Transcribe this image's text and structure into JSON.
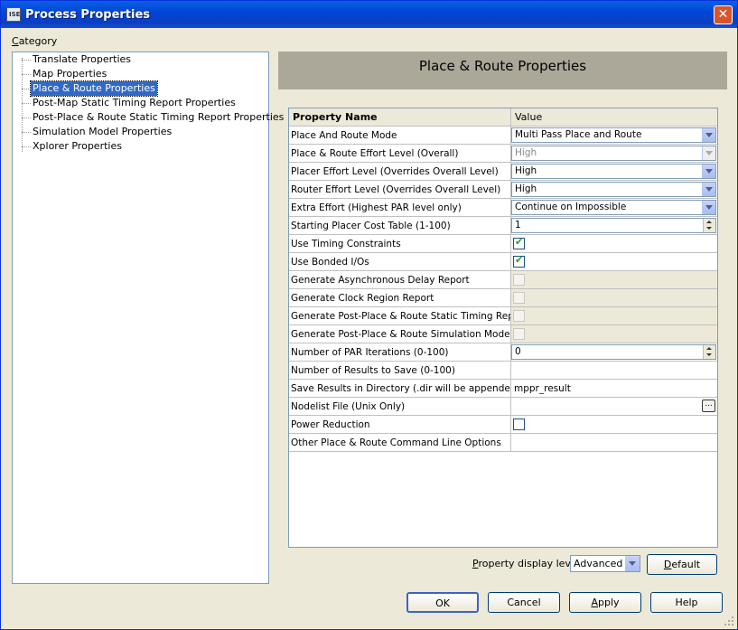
{
  "window": {
    "title": "Process Properties",
    "close": "✕",
    "icon_text": "ISE"
  },
  "category": {
    "label_prefix": "C",
    "label_rest": "ategory",
    "items": [
      {
        "label": "Translate Properties"
      },
      {
        "label": "Map Properties"
      },
      {
        "label": "Place & Route Properties"
      },
      {
        "label": "Post-Map Static Timing Report Properties"
      },
      {
        "label": "Post-Place & Route Static Timing Report Properties"
      },
      {
        "label": "Simulation Model Properties"
      },
      {
        "label": "Xplorer Properties"
      }
    ],
    "selected_index": 2
  },
  "panel": {
    "title": "Place & Route Properties"
  },
  "grid": {
    "headers": {
      "name": "Property Name",
      "value": "Value"
    },
    "rows": [
      {
        "name": "Place And Route Mode",
        "type": "combo",
        "value": "Multi Pass Place and Route"
      },
      {
        "name": "Place & Route Effort Level (Overall)",
        "type": "combo-disabled",
        "value": "High"
      },
      {
        "name": "Placer Effort Level (Overrides Overall Level)",
        "type": "combo",
        "value": "High"
      },
      {
        "name": "Router Effort Level (Overrides Overall Level)",
        "type": "combo",
        "value": "High"
      },
      {
        "name": "Extra Effort (Highest PAR level only)",
        "type": "combo",
        "value": "Continue on Impossible"
      },
      {
        "name": "Starting Placer Cost Table (1-100)",
        "type": "spin",
        "value": "1"
      },
      {
        "name": "Use Timing Constraints",
        "type": "check",
        "checked": true
      },
      {
        "name": "Use Bonded I/Os",
        "type": "check",
        "checked": true
      },
      {
        "name": "Generate Asynchronous Delay Report",
        "type": "check-disabled",
        "checked": false
      },
      {
        "name": "Generate Clock Region Report",
        "type": "check-disabled",
        "checked": false
      },
      {
        "name": "Generate Post-Place & Route Static Timing Report",
        "type": "check-disabled",
        "checked": false
      },
      {
        "name": "Generate Post-Place & Route Simulation Model",
        "type": "check-disabled",
        "checked": false
      },
      {
        "name": "Number of PAR Iterations (0-100)",
        "type": "spin",
        "value": "0"
      },
      {
        "name": "Number of Results to Save (0-100)",
        "type": "text",
        "value": ""
      },
      {
        "name": "Save Results in Directory (.dir will be appended)",
        "type": "text",
        "value": "mppr_result"
      },
      {
        "name": "Nodelist File (Unix Only)",
        "type": "file",
        "value": "",
        "button": "..."
      },
      {
        "name": "Power Reduction",
        "type": "check",
        "checked": false
      },
      {
        "name": "Other Place & Route Command Line Options",
        "type": "text",
        "value": ""
      }
    ]
  },
  "display_level": {
    "label": "Property display level:",
    "value": "Advanced",
    "default_button": "Default"
  },
  "buttons": {
    "ok": "OK",
    "cancel": "Cancel",
    "apply": "Apply",
    "help": "Help"
  }
}
